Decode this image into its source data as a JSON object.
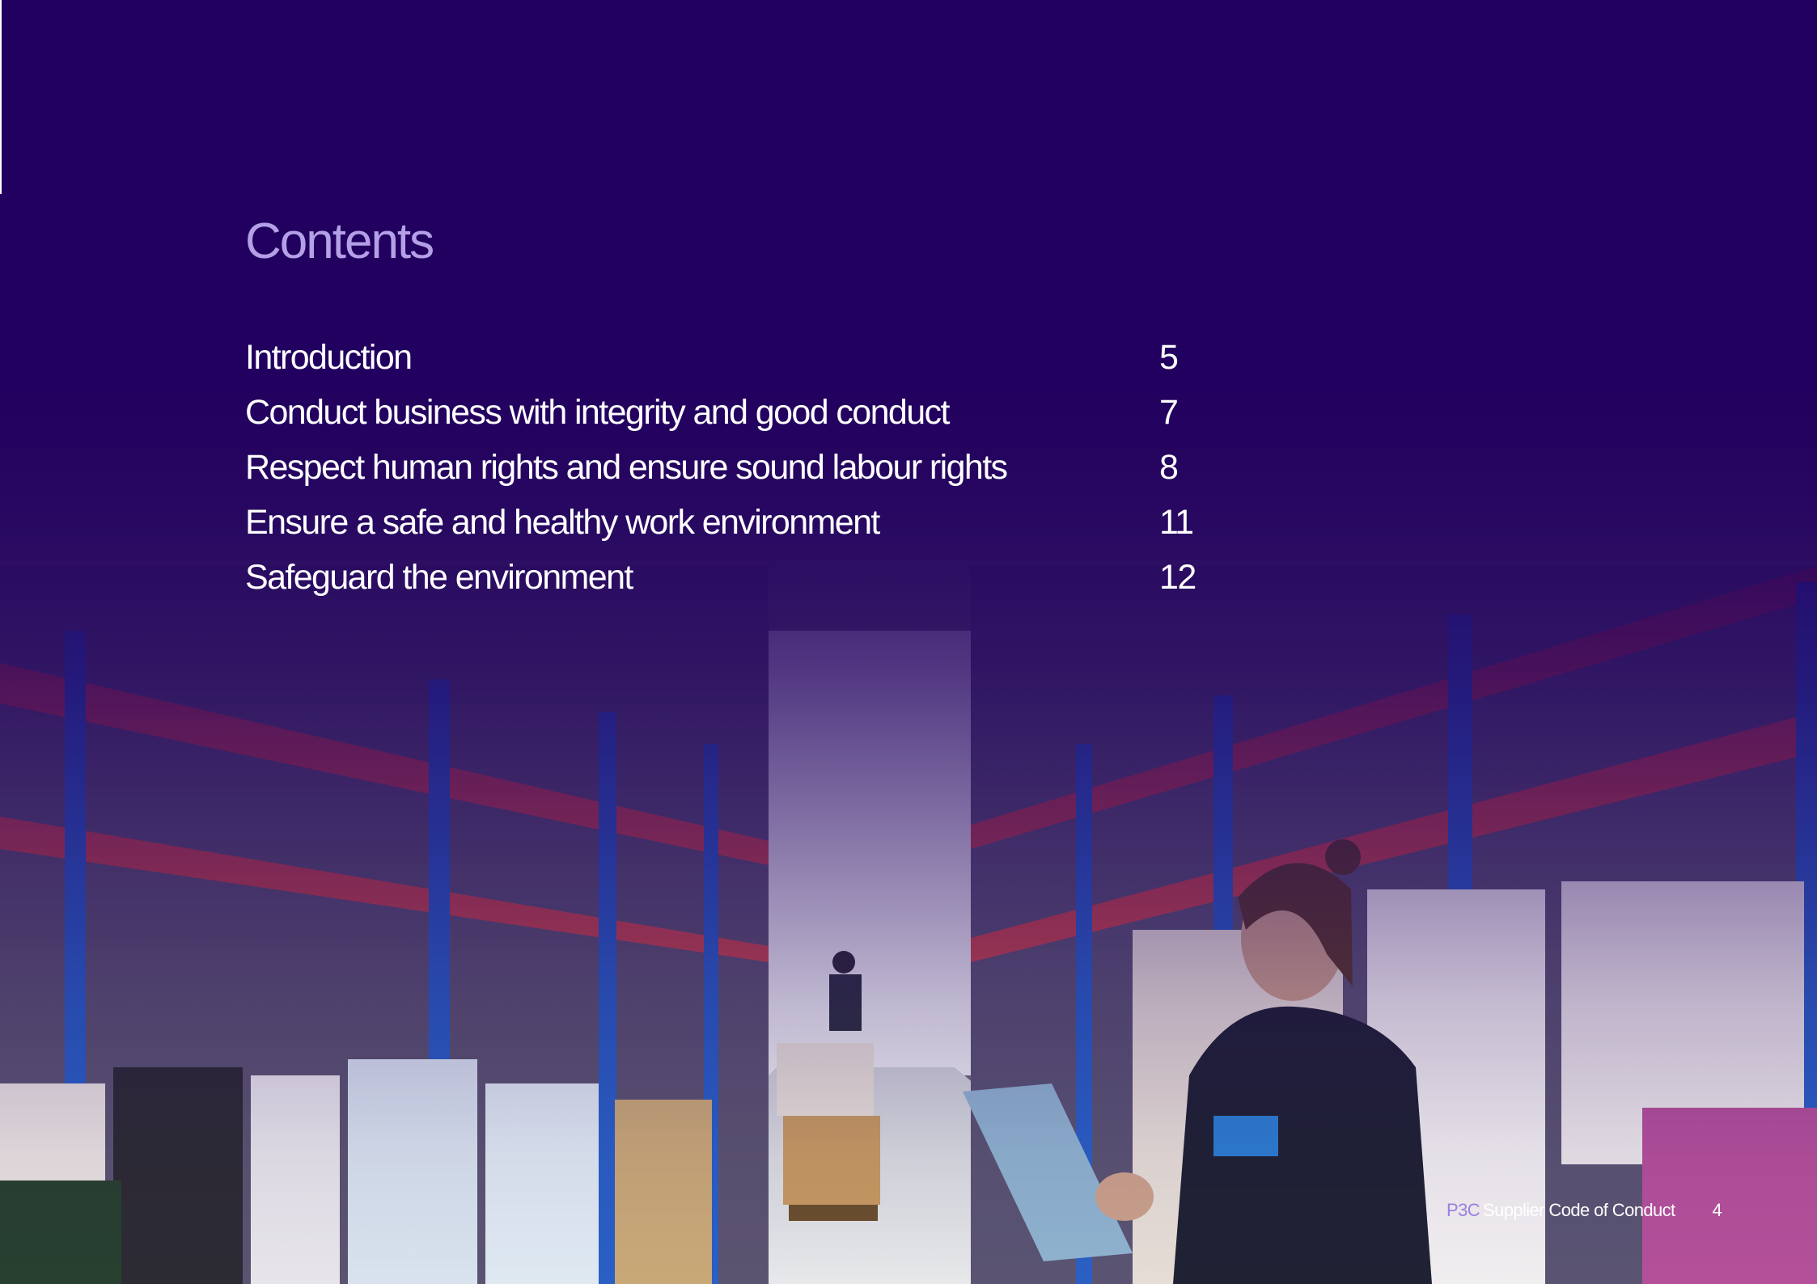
{
  "contents": {
    "title": "Contents",
    "items": [
      {
        "label": "Introduction",
        "page": "5"
      },
      {
        "label": "Conduct business with integrity and good conduct",
        "page": "7"
      },
      {
        "label": "Respect human rights and ensure sound labour rights",
        "page": "8"
      },
      {
        "label": "Ensure a safe and healthy work environment",
        "page": "11"
      },
      {
        "label": "Safeguard the environment",
        "page": "12"
      }
    ]
  },
  "footer": {
    "brand": "P3C",
    "document_title": "Supplier Code of Conduct",
    "page_number": "4"
  },
  "colors": {
    "background": "#22005f",
    "title": "#b4a0e6",
    "text": "#ffffff",
    "brand_accent": "#9b7fe0"
  }
}
